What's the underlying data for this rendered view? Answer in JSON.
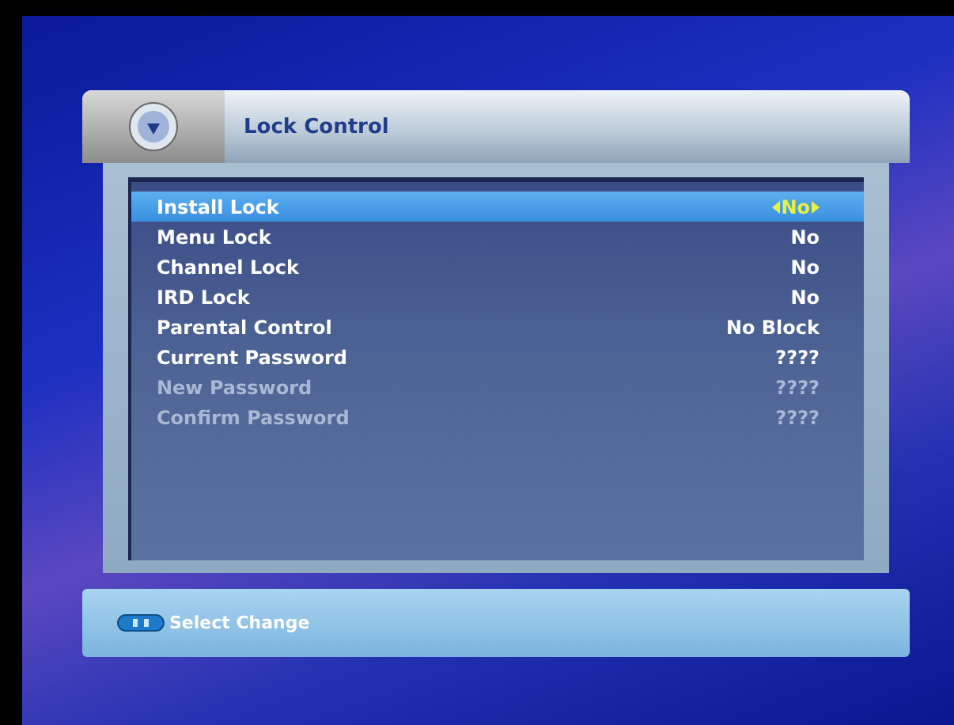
{
  "header": {
    "title": "Lock Control"
  },
  "menu": [
    {
      "label": "Install Lock",
      "value": "No",
      "selected": true,
      "disabled": false
    },
    {
      "label": "Menu Lock",
      "value": "No",
      "selected": false,
      "disabled": false
    },
    {
      "label": "Channel Lock",
      "value": "No",
      "selected": false,
      "disabled": false
    },
    {
      "label": "IRD Lock",
      "value": "No",
      "selected": false,
      "disabled": false
    },
    {
      "label": "Parental Control",
      "value": "No Block",
      "selected": false,
      "disabled": false
    },
    {
      "label": "Current Password",
      "value": "????",
      "selected": false,
      "disabled": false
    },
    {
      "label": "New Password",
      "value": "????",
      "selected": false,
      "disabled": true
    },
    {
      "label": "Confirm Password",
      "value": "????",
      "selected": false,
      "disabled": true
    }
  ],
  "footer": {
    "hint": "Select Change"
  }
}
